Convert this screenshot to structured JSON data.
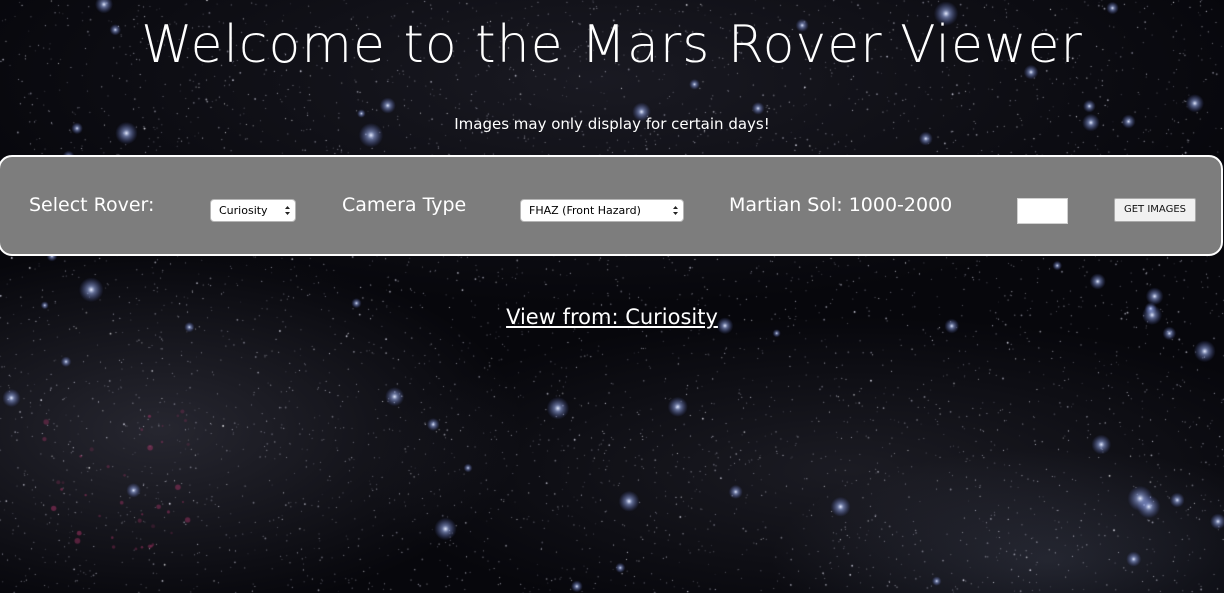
{
  "header": {
    "title": "Welcome to the Mars Rover Viewer",
    "subtitle": "Images may only display for certain days!"
  },
  "controls": {
    "rover_label": "Select Rover:",
    "rover_selected": "Curiosity",
    "camera_label": "Camera Type",
    "camera_selected": "FHAZ (Front Hazard)",
    "sol_label": "Martian Sol: 1000-2000",
    "sol_value": "",
    "get_images_label": "GET IMAGES"
  },
  "view": {
    "heading": "View from: Curiosity"
  },
  "colors": {
    "panel_background": "#7d7d7d",
    "panel_border": "#ffffff",
    "text": "#ffffff",
    "page_background": "#07070c"
  }
}
